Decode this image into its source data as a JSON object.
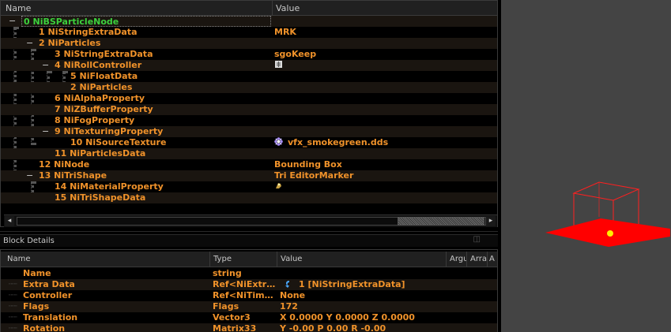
{
  "tree": {
    "columns": {
      "name": "Name",
      "value": "Value"
    },
    "rows": [
      {
        "label": "0 NiBSParticleNode",
        "value": "",
        "toggle": "−"
      },
      {
        "label": "1 NiStringExtraData",
        "value": "MRK",
        "toggle": ""
      },
      {
        "label": "2 NiParticles",
        "value": "",
        "toggle": "−"
      },
      {
        "label": "3 NiStringExtraData",
        "value": "sgoKeep",
        "toggle": ""
      },
      {
        "label": "4 NiRollController",
        "value": "",
        "toggle": "−"
      },
      {
        "label": "5 NiFloatData",
        "value": "",
        "toggle": ""
      },
      {
        "label": "2 NiParticles",
        "value": "",
        "toggle": ""
      },
      {
        "label": "6 NiAlphaProperty",
        "value": "",
        "toggle": ""
      },
      {
        "label": "7 NiZBufferProperty",
        "value": "",
        "toggle": ""
      },
      {
        "label": "8 NiFogProperty",
        "value": "",
        "toggle": ""
      },
      {
        "label": "9 NiTexturingProperty",
        "value": "",
        "toggle": "−"
      },
      {
        "label": "10 NiSourceTexture",
        "value": "vfx_smokegreen.dds",
        "toggle": ""
      },
      {
        "label": "11 NiParticlesData",
        "value": "",
        "toggle": ""
      },
      {
        "label": "12 NiNode",
        "value": "Bounding Box",
        "toggle": ""
      },
      {
        "label": "13 NiTriShape",
        "value": "Tri EditorMarker",
        "toggle": "−"
      },
      {
        "label": "14 NiMaterialProperty",
        "value": "",
        "toggle": ""
      },
      {
        "label": "15 NiTriShapeData",
        "value": "",
        "toggle": ""
      }
    ]
  },
  "block_details": {
    "title": "Block Details",
    "columns": {
      "name": "Name",
      "type": "Type",
      "value": "Value",
      "argument": "Argu",
      "array": "Arra",
      "a": "A"
    },
    "rows": [
      {
        "name": "Name",
        "type": "string",
        "value": ""
      },
      {
        "name": "Extra Data",
        "type": "Ref<NiExtr…",
        "value": "1 [NiStringExtraData]"
      },
      {
        "name": "Controller",
        "type": "Ref<NiTim…",
        "value": "None"
      },
      {
        "name": "Flags",
        "type": "Flags",
        "value": "172"
      },
      {
        "name": "Translation",
        "type": "Vector3",
        "value": "X 0.0000 Y 0.0000 Z 0.0000"
      },
      {
        "name": "Rotation",
        "type": "Matrix33",
        "value": "Y -0.00 P 0.00 R -0.00"
      }
    ]
  },
  "icons": {
    "roll_controller": "gear-small-icon",
    "source_texture": "texture-flower-icon",
    "material_property": "material-icon",
    "extra_data_link": "link-arrow-icon"
  },
  "colors": {
    "node_text": "#f0922a",
    "root_text": "#3dd13d",
    "viewport_bg": "#444444",
    "marker_red": "#ff0000",
    "marker_dot": "#ffee00"
  }
}
